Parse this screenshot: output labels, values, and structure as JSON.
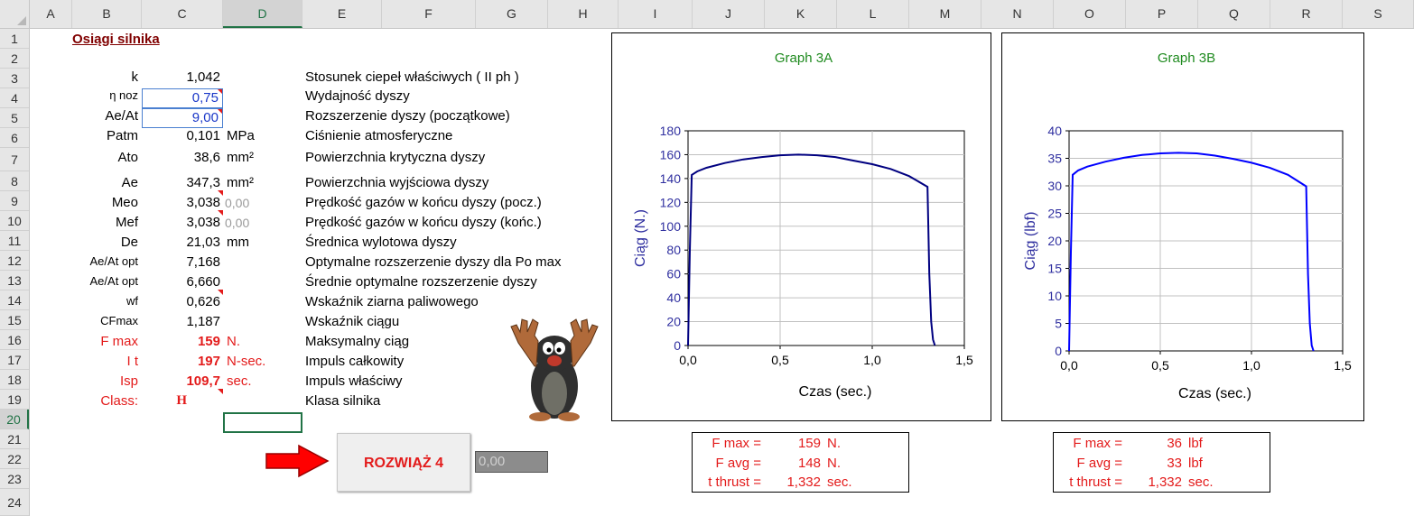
{
  "columns": [
    "A",
    "B",
    "C",
    "D",
    "E",
    "F",
    "G",
    "H",
    "I",
    "J",
    "K",
    "L",
    "M",
    "N",
    "O",
    "P",
    "Q",
    "R",
    "S"
  ],
  "rows": [
    "1",
    "2",
    "3",
    "4",
    "5",
    "6",
    "7",
    "8",
    "9",
    "10",
    "11",
    "12",
    "13",
    "14",
    "15",
    "16",
    "17",
    "18",
    "19",
    "20",
    "21",
    "22",
    "23",
    "24"
  ],
  "title": "Osiągi silnika",
  "params": [
    {
      "label": "k",
      "value": "1,042",
      "unit": "",
      "desc": "Stosunek ciepeł właściwych ( II ph )"
    },
    {
      "label": "η noz",
      "value": "0,75",
      "unit": "",
      "desc": "Wydajność dyszy"
    },
    {
      "label": "Ae/At",
      "value": "9,00",
      "unit": "",
      "desc": "Rozszerzenie dyszy (początkowe)"
    },
    {
      "label": "Patm",
      "value": "0,101",
      "unit": "MPa",
      "desc": "Ciśnienie atmosferyczne"
    },
    {
      "label": "Ato",
      "value": "38,6",
      "unit": "mm²",
      "desc": "Powierzchnia krytyczna dyszy"
    },
    {
      "label": "Ae",
      "value": "347,3",
      "unit": "mm²",
      "desc": "Powierzchnia wyjściowa dyszy"
    },
    {
      "label": "Meo",
      "value": "3,038",
      "extra": "0,00",
      "desc": "Prędkość gazów w końcu dyszy (pocz.)"
    },
    {
      "label": "Mef",
      "value": "3,038",
      "extra": "0,00",
      "desc": "Prędkość gazów w końcu dyszy (końc.)"
    },
    {
      "label": "De",
      "value": "21,03",
      "unit": "mm",
      "desc": "Średnica wylotowa dyszy"
    },
    {
      "label": "Ae/At opt",
      "value": "7,168",
      "unit": "",
      "desc": "Optymalne rozszerzenie dyszy dla Po max"
    },
    {
      "label": "Ae/At opt",
      "value": "6,660",
      "unit": "",
      "desc": "Średnie optymalne rozszerzenie dyszy"
    },
    {
      "label": "wf",
      "value": "0,626",
      "unit": "",
      "desc": "Wskaźnik ziarna paliwowego"
    },
    {
      "label": "CFmax",
      "value": "1,187",
      "unit": "",
      "desc": "Wskaźnik ciągu"
    },
    {
      "label": "F max",
      "value": "159",
      "unit": "N.",
      "desc": "Maksymalny ciąg"
    },
    {
      "label": "I t",
      "value": "197",
      "unit": "N-sec.",
      "desc": "Impuls całkowity"
    },
    {
      "label": "Isp",
      "value": "109,7",
      "unit": "sec.",
      "desc": "Impuls właściwy"
    },
    {
      "label": "Class:",
      "value": "H",
      "unit": "",
      "desc": "Klasa silnika"
    }
  ],
  "button": {
    "label": "ROZWIĄŻ 4"
  },
  "result_box": {
    "value": "0,00"
  },
  "box_left": [
    {
      "label": "F max =",
      "value": "159",
      "unit": "N."
    },
    {
      "label": "F avg =",
      "value": "148",
      "unit": "N."
    },
    {
      "label": "t thrust =",
      "value": "1,332",
      "unit": "sec."
    }
  ],
  "box_right": [
    {
      "label": "F max =",
      "value": "36",
      "unit": "lbf"
    },
    {
      "label": "F avg =",
      "value": "33",
      "unit": "lbf"
    },
    {
      "label": "t thrust =",
      "value": "1,332",
      "unit": "sec."
    }
  ],
  "colors": {
    "title": "#800000",
    "red": "#e31b1b",
    "input_blue": "#1a37c8",
    "chart_title": "#1e8a1e",
    "axis_label": "#3030a0",
    "line_a": "#000080",
    "line_b": "#0000ff"
  },
  "chart_data": [
    {
      "type": "line",
      "title": "Graph 3A",
      "xlabel": "Czas (sec.)",
      "ylabel": "Ciąg (N.)",
      "xlim": [
        0,
        1.5
      ],
      "ylim": [
        0,
        180
      ],
      "xticks": [
        "0,0",
        "0,5",
        "1,0",
        "1,5"
      ],
      "yticks": [
        "0",
        "20",
        "40",
        "60",
        "80",
        "100",
        "120",
        "140",
        "160",
        "180"
      ],
      "grid": true,
      "series": [
        {
          "x": [
            0,
            0.01,
            0.02,
            0.05,
            0.1,
            0.2,
            0.3,
            0.4,
            0.5,
            0.6,
            0.7,
            0.8,
            0.9,
            1.0,
            1.1,
            1.2,
            1.3,
            1.31,
            1.32,
            1.33,
            1.34
          ],
          "values": [
            0,
            80,
            143,
            146,
            149,
            153,
            156,
            158,
            159.5,
            160,
            159.5,
            158,
            155,
            152,
            148,
            142,
            133,
            60,
            20,
            5,
            0
          ]
        }
      ]
    },
    {
      "type": "line",
      "title": "Graph 3B",
      "xlabel": "Czas (sec.)",
      "ylabel": "Ciąg (lbf)",
      "xlim": [
        0,
        1.5
      ],
      "ylim": [
        0,
        40
      ],
      "xticks": [
        "0,0",
        "0,5",
        "1,0",
        "1,5"
      ],
      "yticks": [
        "0",
        "5",
        "10",
        "15",
        "20",
        "25",
        "30",
        "35",
        "40"
      ],
      "grid": true,
      "series": [
        {
          "x": [
            0,
            0.01,
            0.02,
            0.05,
            0.1,
            0.2,
            0.3,
            0.4,
            0.5,
            0.6,
            0.7,
            0.8,
            0.9,
            1.0,
            1.1,
            1.2,
            1.3,
            1.31,
            1.32,
            1.33,
            1.34
          ],
          "values": [
            0,
            18,
            32,
            32.8,
            33.5,
            34.4,
            35.1,
            35.6,
            35.9,
            36,
            35.9,
            35.5,
            34.9,
            34.2,
            33.3,
            32,
            29.9,
            14,
            5,
            1,
            0
          ]
        }
      ]
    }
  ]
}
